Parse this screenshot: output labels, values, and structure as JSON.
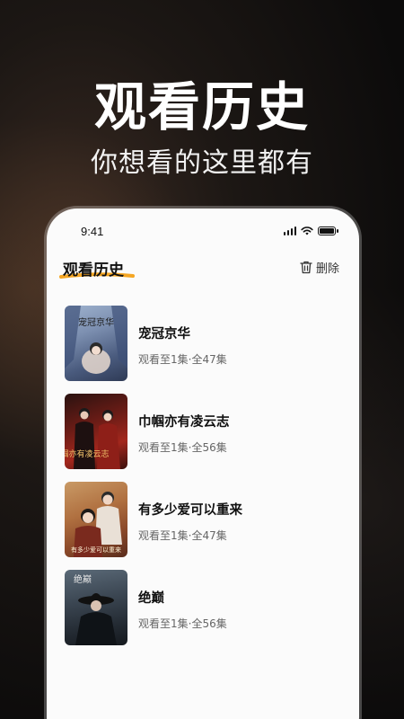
{
  "hero": {
    "title": "观看历史",
    "subtitle": "你想看的这里都有"
  },
  "status_bar": {
    "time": "9:41"
  },
  "header": {
    "title": "观看历史",
    "delete_label": "删除"
  },
  "colors": {
    "accent_underline": "#f5a623",
    "text_primary": "#111111",
    "text_secondary": "#666666"
  },
  "history": [
    {
      "title": "宠冠京华",
      "progress": "观看至1集·全47集",
      "poster_text": "宠冠京华"
    },
    {
      "title": "巾帼亦有凌云志",
      "progress": "观看至1集·全56集",
      "poster_text": "巾帼亦有凌云志"
    },
    {
      "title": "有多少爱可以重来",
      "progress": "观看至1集·全47集",
      "poster_text": "有多少爱可以重来"
    },
    {
      "title": "绝巅",
      "progress": "观看至1集·全56集",
      "poster_text": "绝巅"
    }
  ]
}
